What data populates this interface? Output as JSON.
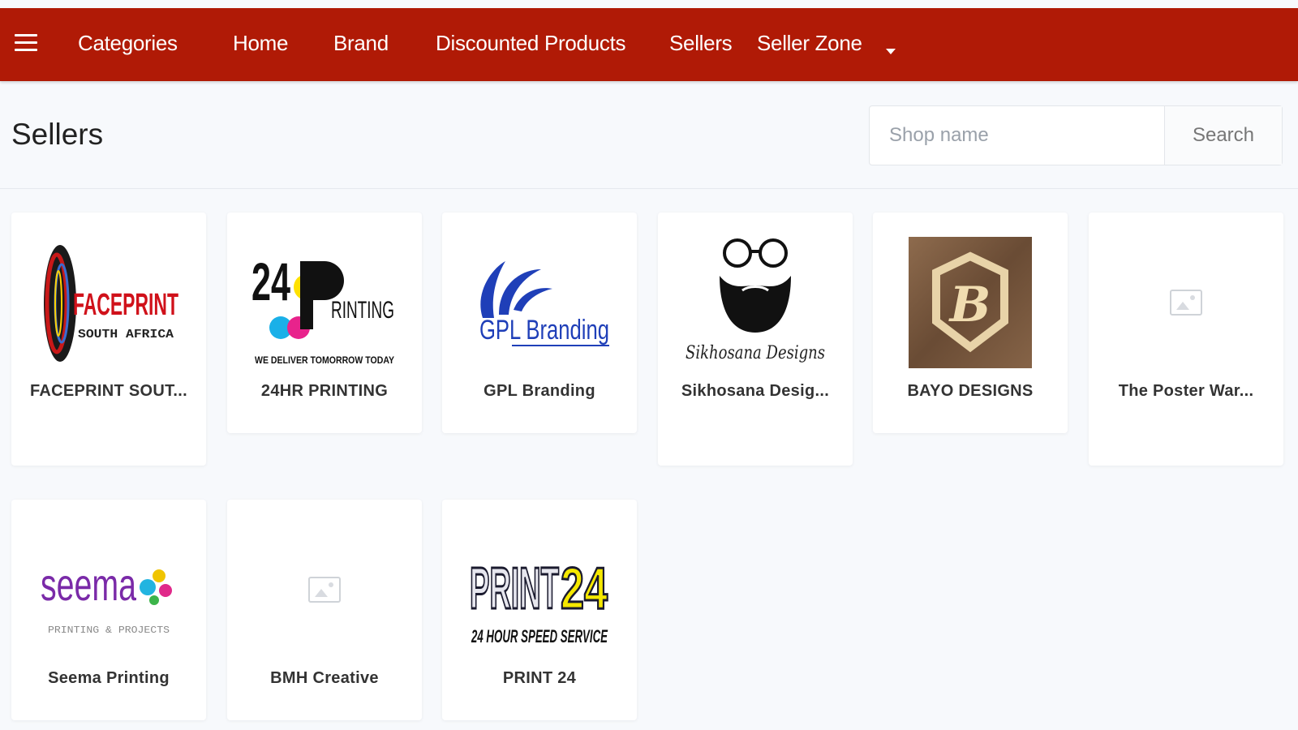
{
  "nav": {
    "items": [
      {
        "label": "Categories"
      },
      {
        "label": "Home"
      },
      {
        "label": "Brand"
      },
      {
        "label": "Discounted Products"
      },
      {
        "label": "Sellers"
      },
      {
        "label": "Seller Zone"
      }
    ],
    "menu_icon": "hamburger-icon",
    "dropdown_icon": "caret-down-icon",
    "bg_color": "#b01a06"
  },
  "page": {
    "title": "Sellers"
  },
  "search": {
    "placeholder": "Shop name",
    "button_label": "Search"
  },
  "sellers": [
    {
      "name": "FACEPRINT SOUT...",
      "logo": {
        "lines": [
          "FACEPRINT",
          "SOUTH AFRICA"
        ]
      }
    },
    {
      "name": "24HR PRINTING",
      "logo": {
        "lines": [
          "24",
          "PRINTING",
          "WE DELIVER TOMORROW TODAY"
        ]
      }
    },
    {
      "name": "GPL Branding",
      "logo": {
        "lines": [
          "GPL Branding"
        ]
      }
    },
    {
      "name": "Sikhosana Desig...",
      "logo": {
        "lines": [
          "Sikhosana Designs"
        ]
      }
    },
    {
      "name": "BAYO DESIGNS",
      "logo": {
        "lines": [
          "B"
        ]
      }
    },
    {
      "name": "The Poster War...",
      "logo": {
        "placeholder": "image-placeholder-icon"
      }
    },
    {
      "name": "Seema Printing",
      "logo": {
        "lines": [
          "seema",
          "PRINTING & PROJECTS"
        ]
      }
    },
    {
      "name": "BMH Creative",
      "logo": {
        "placeholder": "image-placeholder-icon"
      }
    },
    {
      "name": "PRINT 24",
      "logo": {
        "lines": [
          "PRINT",
          "24",
          "24 HOUR SPEED SERVICE"
        ]
      }
    }
  ]
}
